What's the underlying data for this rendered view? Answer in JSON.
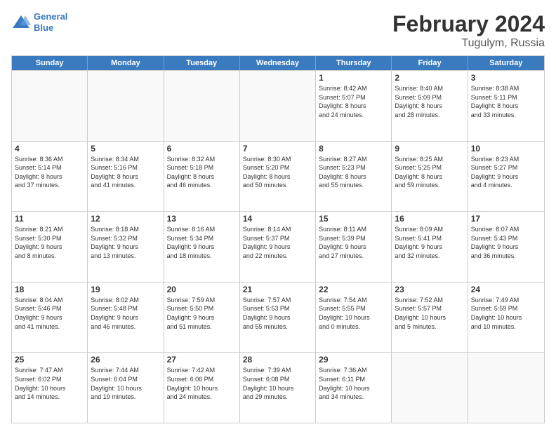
{
  "header": {
    "logo_line1": "General",
    "logo_line2": "Blue",
    "month_title": "February 2024",
    "location": "Tugulym, Russia"
  },
  "days_of_week": [
    "Sunday",
    "Monday",
    "Tuesday",
    "Wednesday",
    "Thursday",
    "Friday",
    "Saturday"
  ],
  "rows": [
    [
      {
        "day": "",
        "info": ""
      },
      {
        "day": "",
        "info": ""
      },
      {
        "day": "",
        "info": ""
      },
      {
        "day": "",
        "info": ""
      },
      {
        "day": "1",
        "info": "Sunrise: 8:42 AM\nSunset: 5:07 PM\nDaylight: 8 hours\nand 24 minutes."
      },
      {
        "day": "2",
        "info": "Sunrise: 8:40 AM\nSunset: 5:09 PM\nDaylight: 8 hours\nand 28 minutes."
      },
      {
        "day": "3",
        "info": "Sunrise: 8:38 AM\nSunset: 5:11 PM\nDaylight: 8 hours\nand 33 minutes."
      }
    ],
    [
      {
        "day": "4",
        "info": "Sunrise: 8:36 AM\nSunset: 5:14 PM\nDaylight: 8 hours\nand 37 minutes."
      },
      {
        "day": "5",
        "info": "Sunrise: 8:34 AM\nSunset: 5:16 PM\nDaylight: 8 hours\nand 41 minutes."
      },
      {
        "day": "6",
        "info": "Sunrise: 8:32 AM\nSunset: 5:18 PM\nDaylight: 8 hours\nand 46 minutes."
      },
      {
        "day": "7",
        "info": "Sunrise: 8:30 AM\nSunset: 5:20 PM\nDaylight: 8 hours\nand 50 minutes."
      },
      {
        "day": "8",
        "info": "Sunrise: 8:27 AM\nSunset: 5:23 PM\nDaylight: 8 hours\nand 55 minutes."
      },
      {
        "day": "9",
        "info": "Sunrise: 8:25 AM\nSunset: 5:25 PM\nDaylight: 8 hours\nand 59 minutes."
      },
      {
        "day": "10",
        "info": "Sunrise: 8:23 AM\nSunset: 5:27 PM\nDaylight: 9 hours\nand 4 minutes."
      }
    ],
    [
      {
        "day": "11",
        "info": "Sunrise: 8:21 AM\nSunset: 5:30 PM\nDaylight: 9 hours\nand 8 minutes."
      },
      {
        "day": "12",
        "info": "Sunrise: 8:18 AM\nSunset: 5:32 PM\nDaylight: 9 hours\nand 13 minutes."
      },
      {
        "day": "13",
        "info": "Sunrise: 8:16 AM\nSunset: 5:34 PM\nDaylight: 9 hours\nand 18 minutes."
      },
      {
        "day": "14",
        "info": "Sunrise: 8:14 AM\nSunset: 5:37 PM\nDaylight: 9 hours\nand 22 minutes."
      },
      {
        "day": "15",
        "info": "Sunrise: 8:11 AM\nSunset: 5:39 PM\nDaylight: 9 hours\nand 27 minutes."
      },
      {
        "day": "16",
        "info": "Sunrise: 8:09 AM\nSunset: 5:41 PM\nDaylight: 9 hours\nand 32 minutes."
      },
      {
        "day": "17",
        "info": "Sunrise: 8:07 AM\nSunset: 5:43 PM\nDaylight: 9 hours\nand 36 minutes."
      }
    ],
    [
      {
        "day": "18",
        "info": "Sunrise: 8:04 AM\nSunset: 5:46 PM\nDaylight: 9 hours\nand 41 minutes."
      },
      {
        "day": "19",
        "info": "Sunrise: 8:02 AM\nSunset: 5:48 PM\nDaylight: 9 hours\nand 46 minutes."
      },
      {
        "day": "20",
        "info": "Sunrise: 7:59 AM\nSunset: 5:50 PM\nDaylight: 9 hours\nand 51 minutes."
      },
      {
        "day": "21",
        "info": "Sunrise: 7:57 AM\nSunset: 5:53 PM\nDaylight: 9 hours\nand 55 minutes."
      },
      {
        "day": "22",
        "info": "Sunrise: 7:54 AM\nSunset: 5:55 PM\nDaylight: 10 hours\nand 0 minutes."
      },
      {
        "day": "23",
        "info": "Sunrise: 7:52 AM\nSunset: 5:57 PM\nDaylight: 10 hours\nand 5 minutes."
      },
      {
        "day": "24",
        "info": "Sunrise: 7:49 AM\nSunset: 5:59 PM\nDaylight: 10 hours\nand 10 minutes."
      }
    ],
    [
      {
        "day": "25",
        "info": "Sunrise: 7:47 AM\nSunset: 6:02 PM\nDaylight: 10 hours\nand 14 minutes."
      },
      {
        "day": "26",
        "info": "Sunrise: 7:44 AM\nSunset: 6:04 PM\nDaylight: 10 hours\nand 19 minutes."
      },
      {
        "day": "27",
        "info": "Sunrise: 7:42 AM\nSunset: 6:06 PM\nDaylight: 10 hours\nand 24 minutes."
      },
      {
        "day": "28",
        "info": "Sunrise: 7:39 AM\nSunset: 6:08 PM\nDaylight: 10 hours\nand 29 minutes."
      },
      {
        "day": "29",
        "info": "Sunrise: 7:36 AM\nSunset: 6:11 PM\nDaylight: 10 hours\nand 34 minutes."
      },
      {
        "day": "",
        "info": ""
      },
      {
        "day": "",
        "info": ""
      }
    ]
  ]
}
